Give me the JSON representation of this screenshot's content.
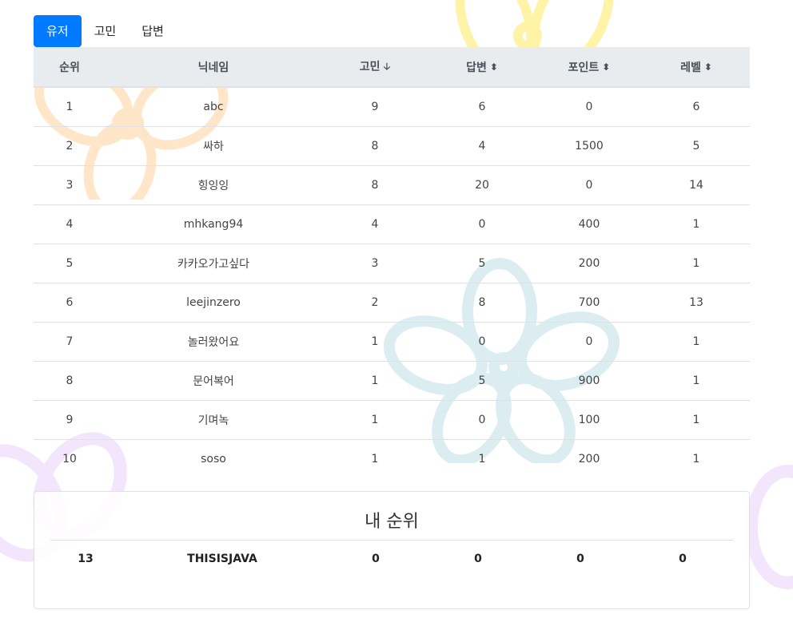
{
  "tabs": [
    {
      "label": "유저",
      "active": true
    },
    {
      "label": "고민",
      "active": false
    },
    {
      "label": "답변",
      "active": false
    }
  ],
  "table": {
    "columns": {
      "rank": "순위",
      "nickname": "닉네임",
      "worries": "고민",
      "answers": "답변",
      "points": "포인트",
      "level": "레벨"
    },
    "sort": {
      "worries": "sorted-desc",
      "answers": "sortable",
      "points": "sortable",
      "level": "sortable"
    },
    "rows": [
      [
        "1",
        "abc",
        "9",
        "6",
        "0",
        "6"
      ],
      [
        "2",
        "싸하",
        "8",
        "4",
        "1500",
        "5"
      ],
      [
        "3",
        "힝잉잉",
        "8",
        "20",
        "0",
        "14"
      ],
      [
        "4",
        "mhkang94",
        "4",
        "0",
        "400",
        "1"
      ],
      [
        "5",
        "카카오가고싶다",
        "3",
        "5",
        "200",
        "1"
      ],
      [
        "6",
        "leejinzero",
        "2",
        "8",
        "700",
        "13"
      ],
      [
        "7",
        "놀러왔어요",
        "1",
        "0",
        "0",
        "1"
      ],
      [
        "8",
        "문어복어",
        "1",
        "5",
        "900",
        "1"
      ],
      [
        "9",
        "기며녹",
        "1",
        "0",
        "100",
        "1"
      ],
      [
        "10",
        "soso",
        "1",
        "1",
        "200",
        "1"
      ]
    ]
  },
  "my_rank": {
    "title": "내 순위",
    "values": [
      "13",
      "THISISJAVA",
      "0",
      "0",
      "0",
      "0"
    ]
  },
  "colors": {
    "accent": "#007bff",
    "header_bg": "#e9ecef",
    "flower_yellow": "#fff3a8",
    "flower_orange": "#ffe0b8",
    "flower_blue": "#d8ecf0",
    "flower_purple": "#f0e0fb"
  }
}
